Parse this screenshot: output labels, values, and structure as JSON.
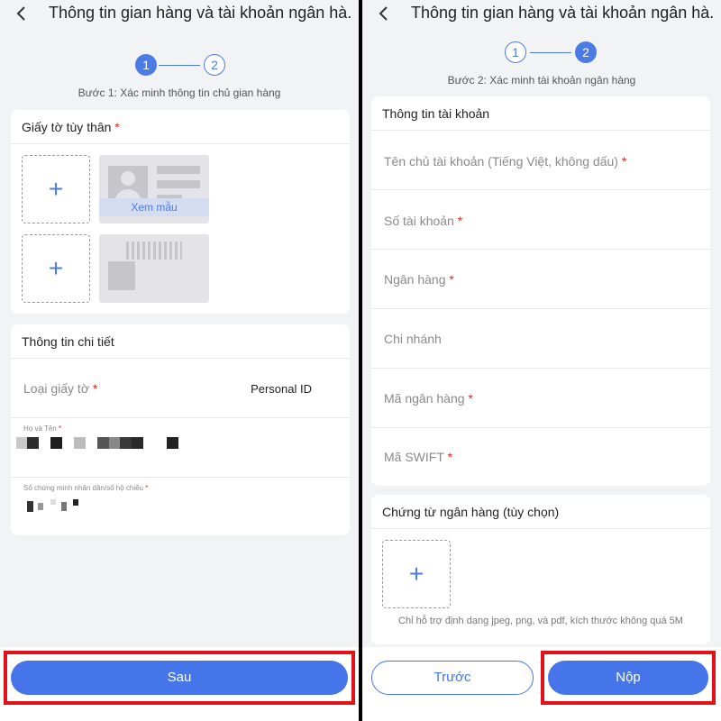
{
  "left_screen": {
    "title": "Thông tin gian hàng và tài khoản ngân hà...",
    "steps": [
      "1",
      "2"
    ],
    "step_caption": "Bước 1: Xác minh thông tin chủ gian hàng",
    "id_card": {
      "header": "Giấy tờ tùy thân",
      "required_mark": "*",
      "upload_plus": "+",
      "sample_label": "Xem mẫu"
    },
    "details": {
      "header": "Thông tin chi tiết",
      "doc_type_label": "Loại giấy tờ",
      "doc_type_value": "Personal ID",
      "name_label": "Họ và Tên",
      "id_number_label": "Số chứng minh nhân dân/số hộ chiếu",
      "required_mark": "*"
    },
    "next_button": "Sau"
  },
  "right_screen": {
    "title": "Thông tin gian hàng và tài khoản ngân hà...",
    "steps": [
      "1",
      "2"
    ],
    "step_caption": "Bước 2: Xác minh tài khoản ngân hàng",
    "account": {
      "header": "Thông tin tài khoản",
      "required_mark": "*",
      "fields": [
        {
          "label": "Tên chủ tài khoản (Tiếng Việt, không dấu)",
          "required": true
        },
        {
          "label": "Số tài khoản",
          "required": true
        },
        {
          "label": "Ngân hàng",
          "required": true
        },
        {
          "label": "Chi nhánh",
          "required": false
        },
        {
          "label": "Mã ngân hàng",
          "required": true
        },
        {
          "label": "Mã SWIFT",
          "required": true
        }
      ]
    },
    "bank_docs": {
      "header": "Chứng từ ngân hàng (tùy chọn)",
      "upload_plus": "+",
      "hint": "Chỉ hỗ trợ định dạng jpeg, png, và pdf, kích thước không quá 5M"
    },
    "prev_button": "Trước",
    "submit_button": "Nộp"
  },
  "colors": {
    "accent": "#4675ea",
    "required": "#e0261f",
    "highlight": "#e2121c",
    "background": "#f2f3f5"
  },
  "icons": [
    "back-chevron-icon",
    "plus-icon",
    "id-card-sample-icon"
  ]
}
